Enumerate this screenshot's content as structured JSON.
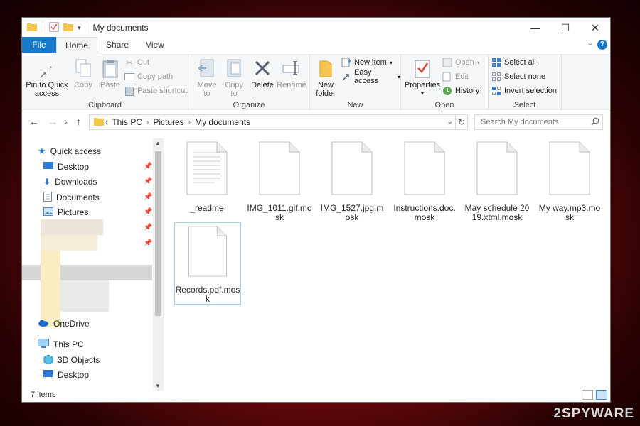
{
  "window": {
    "title": "My documents",
    "controls": {
      "minimize": "—",
      "maximize": "☐",
      "close": "✕"
    }
  },
  "ribbon_tabs": [
    "File",
    "Home",
    "Share",
    "View"
  ],
  "help_label": "?",
  "ribbon": {
    "clipboard": {
      "label": "Clipboard",
      "pin": "Pin to Quick access",
      "copy": "Copy",
      "paste": "Paste",
      "cut": "Cut",
      "copy_path": "Copy path",
      "paste_shortcut": "Paste shortcut"
    },
    "organize": {
      "label": "Organize",
      "move_to": "Move to",
      "copy_to": "Copy to",
      "delete": "Delete",
      "rename": "Rename"
    },
    "new": {
      "label": "New",
      "new_folder": "New folder",
      "new_item": "New item",
      "easy_access": "Easy access"
    },
    "open": {
      "label": "Open",
      "properties": "Properties",
      "open": "Open",
      "edit": "Edit",
      "history": "History"
    },
    "select": {
      "label": "Select",
      "select_all": "Select all",
      "select_none": "Select none",
      "invert_selection": "Invert selection"
    }
  },
  "address": {
    "crumbs": [
      "This PC",
      "Pictures",
      "My documents"
    ],
    "search_placeholder": "Search My documents"
  },
  "nav": {
    "quick_access": "Quick access",
    "quick_items": [
      "Desktop",
      "Downloads",
      "Documents",
      "Pictures"
    ],
    "onedrive": "OneDrive",
    "this_pc": "This PC",
    "pc_items": [
      "3D Objects",
      "Desktop"
    ]
  },
  "files": [
    {
      "name": "_readme",
      "type": "text"
    },
    {
      "name": "IMG_1011.gif.mosk",
      "type": "blank"
    },
    {
      "name": "IMG_1527.jpg.mosk",
      "type": "blank"
    },
    {
      "name": "Instructions.doc.mosk",
      "type": "blank"
    },
    {
      "name": "May schedule 2019.xtml.mosk",
      "type": "blank"
    },
    {
      "name": "My way.mp3.mosk",
      "type": "blank"
    },
    {
      "name": "Records.pdf.mosk",
      "type": "blank",
      "selected": true
    }
  ],
  "status": {
    "items": "7 items"
  },
  "watermark": {
    "two": "2",
    "rest": "SPYWAR",
    "end": "E"
  },
  "colors": {
    "accent": "#1979ca",
    "selection_border": "#99d1ff",
    "background": "#a0141a"
  }
}
